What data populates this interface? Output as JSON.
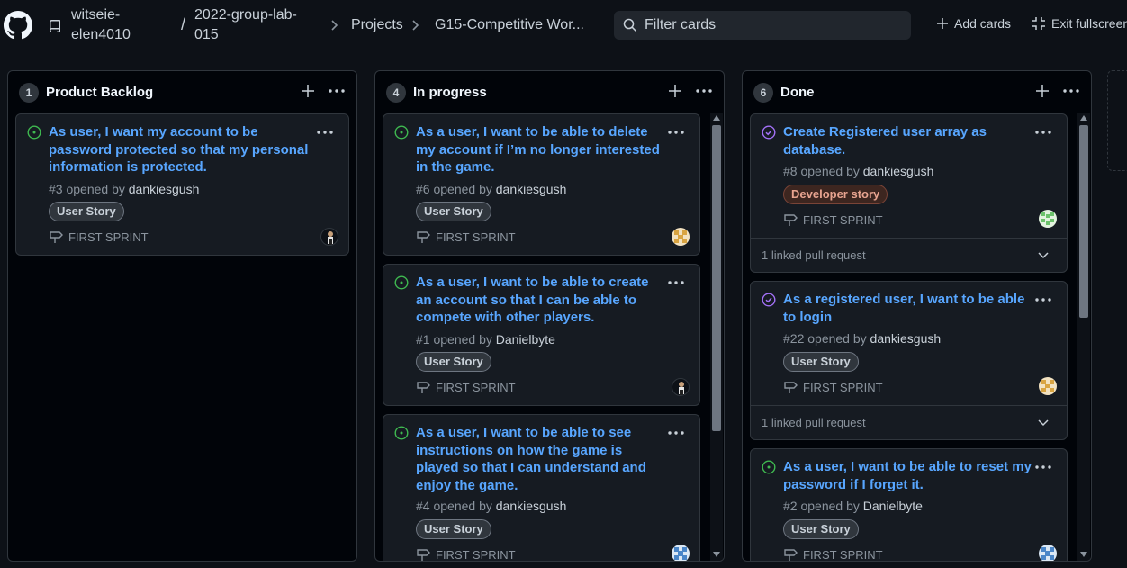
{
  "header": {
    "owner": "witseie-elen4010",
    "repo": "2022-group-lab-015",
    "crumbs": [
      "Projects",
      "G15-Competitive Wor..."
    ],
    "filter_placeholder": "Filter cards",
    "add_cards_label": "Add cards",
    "exit_fullscreen_label": "Exit fullscreen"
  },
  "columns": [
    {
      "title": "Product Backlog",
      "count": "1",
      "cards": [
        {
          "title": "As user, I want my account to be password protected so that my personal information is protected.",
          "number": "#3",
          "opened_by": "opened by",
          "author": "dankiesgush",
          "label": "User Story",
          "sprint": "FIRST SPRINT"
        }
      ]
    },
    {
      "title": "In progress",
      "count": "4",
      "cards": [
        {
          "title": "As a user, I want to be able to delete my account if I’m no longer interested in the game.",
          "number": "#6",
          "opened_by": "opened by",
          "author": "dankiesgush",
          "label": "User Story",
          "sprint": "FIRST SPRINT"
        },
        {
          "title": "As a user, I want to be able to create an account so that I can be able to compete with other players.",
          "number": "#1",
          "opened_by": "opened by",
          "author": "Danielbyte",
          "label": "User Story",
          "sprint": "FIRST SPRINT"
        },
        {
          "title": "As a user, I want to be able to see instructions on how the game is played so that I can understand and enjoy the game.",
          "number": "#4",
          "opened_by": "opened by",
          "author": "dankiesgush",
          "label": "User Story",
          "sprint": "FIRST SPRINT"
        }
      ]
    },
    {
      "title": "Done",
      "count": "6",
      "cards": [
        {
          "title": "Create Registered user array as database.",
          "number": "#8",
          "opened_by": "opened by",
          "author": "dankiesgush",
          "label": "Developer story",
          "sprint": "FIRST SPRINT",
          "linked": "1 linked pull request"
        },
        {
          "title": "As a registered user, I want to be able to login",
          "number": "#22",
          "opened_by": "opened by",
          "author": "dankiesgush",
          "label": "User Story",
          "sprint": "FIRST SPRINT",
          "linked": "1 linked pull request"
        },
        {
          "title": "As a user, I want to be able to reset my password if I forget it.",
          "number": "#2",
          "opened_by": "opened by",
          "author": "Danielbyte",
          "label": "User Story",
          "sprint": "FIRST SPRINT"
        }
      ]
    }
  ],
  "colors": {
    "open_issue": "#3fb950",
    "closed_issue": "#a371f7",
    "link": "#58a6ff"
  }
}
